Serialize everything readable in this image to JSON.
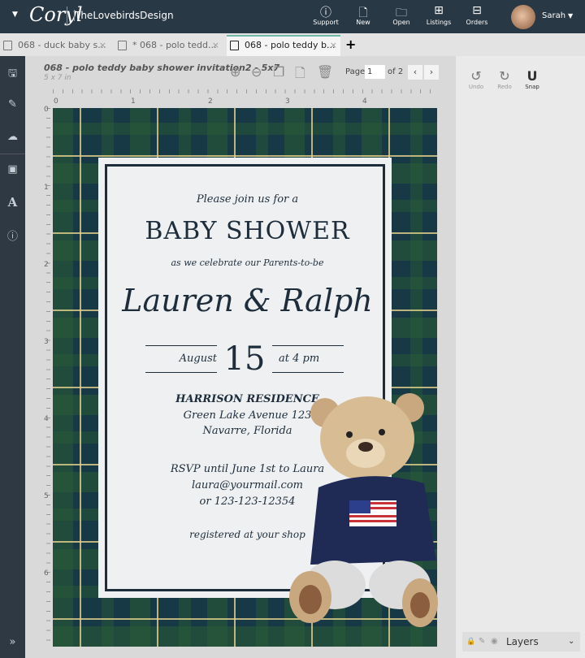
{
  "header": {
    "logo": "Coryl",
    "brand": "TheLovebirdsDesign",
    "nav": [
      {
        "label": "Support",
        "icon": "?"
      },
      {
        "label": "New",
        "icon": "+"
      },
      {
        "label": "Open",
        "icon": "▭"
      },
      {
        "label": "Listings",
        "icon": "🎁"
      },
      {
        "label": "Orders",
        "icon": "🛒"
      }
    ],
    "user": "Sarah"
  },
  "tabs": [
    {
      "label": "068 - duck baby s..."
    },
    {
      "label": "* 068 - polo tedd..."
    },
    {
      "label": "068 - polo teddy b..."
    }
  ],
  "document": {
    "title": "068 - polo teddy baby shower invitation2 - 5x7",
    "size": "5 x 7 in",
    "page_label": "Page",
    "page": "1",
    "of": "of 2"
  },
  "ruler": {
    "h": [
      "0",
      "1",
      "2",
      "3",
      "4"
    ],
    "v": [
      "0",
      "1",
      "2",
      "3",
      "4",
      "5",
      "6"
    ]
  },
  "invite": {
    "line1": "Please join us for a",
    "title": "BABY SHOWER",
    "line2": "as we celebrate our Parents-to-be",
    "names": "Lauren & Ralph",
    "month": "August",
    "day": "15",
    "time": "at 4 pm",
    "venue": "HARRISON RESIDENCE",
    "street": "Green Lake Avenue 123",
    "city": "Navarre, Florida",
    "rsvp": "RSVP until June 1st to Laura",
    "email": "laura@yourmail.com",
    "phone": "or 123-123-12354",
    "registry": "registered at your shop"
  },
  "right_panel": {
    "undo": "Undo",
    "redo": "Redo",
    "snap": "Snap",
    "layers": "Layers"
  },
  "colors": {
    "topbar": "#293845",
    "accent": "#6fb8a8",
    "ink": "#1e2d3b",
    "plaid": "#173845"
  }
}
